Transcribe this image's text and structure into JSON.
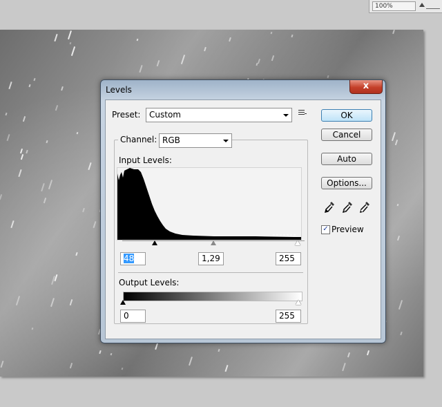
{
  "app": {
    "zoom_level": "100%"
  },
  "dialog": {
    "title": "Levels",
    "close_label": "x",
    "preset": {
      "label": "Preset:",
      "value": "Custom"
    },
    "channel": {
      "label": "Channel:",
      "value": "RGB"
    },
    "input_levels": {
      "label": "Input Levels:",
      "black": "48",
      "gamma": "1,29",
      "white": "255"
    },
    "output_levels": {
      "label": "Output Levels:",
      "black": "0",
      "white": "255"
    },
    "buttons": {
      "ok": "OK",
      "cancel": "Cancel",
      "auto": "Auto",
      "options": "Options..."
    },
    "preview": {
      "label": "Preview",
      "checked": true
    },
    "colors": {
      "accent": "#3399ff",
      "close": "#c4402a"
    }
  }
}
